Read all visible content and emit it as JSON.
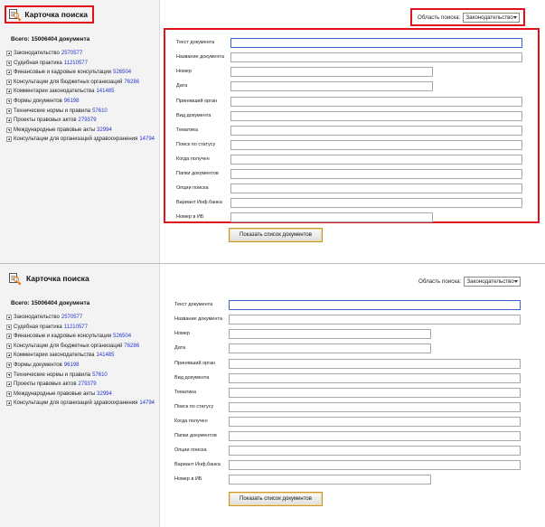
{
  "app": {
    "title": "Карточка поиска"
  },
  "sidebar": {
    "total": "Всего: 15006404 документа",
    "items": [
      {
        "label": "Законодательство",
        "count": "2570577"
      },
      {
        "label": "Судебная практика",
        "count": "11210577"
      },
      {
        "label": "Финансовые и кадровые консультации",
        "count": "526504"
      },
      {
        "label": "Консультации для бюджетных организаций",
        "count": "76286"
      },
      {
        "label": "Комментарии законодательства",
        "count": "141485"
      },
      {
        "label": "Формы документов",
        "count": "96198"
      },
      {
        "label": "Технические нормы и правила",
        "count": "57610"
      },
      {
        "label": "Проекты правовых актов",
        "count": "279379"
      },
      {
        "label": "Международные правовые акты",
        "count": "32994"
      },
      {
        "label": "Консультации для организаций здравоохранения",
        "count": "14794"
      }
    ]
  },
  "search_area": {
    "label": "Область поиска:",
    "selected": "Законодательство"
  },
  "form": {
    "fields": [
      {
        "label": "Текст документа",
        "value": ""
      },
      {
        "label": "Название документа",
        "value": ""
      },
      {
        "label": "Номер",
        "value": ""
      },
      {
        "label": "Дата",
        "value": ""
      },
      {
        "label": "Принявший орган",
        "value": ""
      },
      {
        "label": "Вид документа",
        "value": ""
      },
      {
        "label": "Тематика",
        "value": ""
      },
      {
        "label": "Поиск по статусу",
        "value": ""
      },
      {
        "label": "Когда получен",
        "value": ""
      },
      {
        "label": "Папки документов",
        "value": ""
      },
      {
        "label": "Опции поиска",
        "value": ""
      },
      {
        "label": "Вариант Инф.банка",
        "value": ""
      },
      {
        "label": "Номер в ИБ",
        "value": ""
      }
    ],
    "submit_label": "Показать список документов"
  },
  "colors": {
    "highlight": "#e0131d",
    "count_link": "#2233cc",
    "button_border": "#c79a2e",
    "focus": "#3a64c6"
  },
  "icons": {
    "logo": "document-search-icon",
    "tree_toggle": "plus-box-icon",
    "select_arrow": "chevron-down-icon"
  }
}
